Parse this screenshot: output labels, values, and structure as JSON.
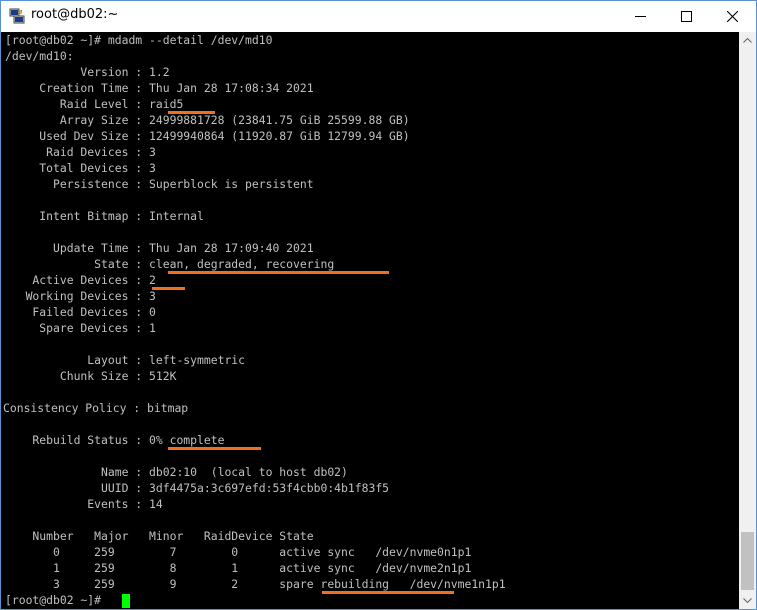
{
  "window": {
    "title": "root@db02:~",
    "icon": "putty-icon",
    "controls": [
      "minimize-icon",
      "maximize-icon",
      "close-icon"
    ]
  },
  "terminal": {
    "lines": [
      "[root@db02 ~]# mdadm --detail /dev/md10",
      "/dev/md10:",
      "           Version : 1.2",
      "     Creation Time : Thu Jan 28 17:08:34 2021",
      "        Raid Level : raid5",
      "        Array Size : 24999881728 (23841.75 GiB 25599.88 GB)",
      "     Used Dev Size : 12499940864 (11920.87 GiB 12799.94 GB)",
      "      Raid Devices : 3",
      "     Total Devices : 3",
      "       Persistence : Superblock is persistent",
      "",
      "     Intent Bitmap : Internal",
      "",
      "       Update Time : Thu Jan 28 17:09:40 2021",
      "             State : clean, degraded, recovering",
      "    Active Devices : 2",
      "   Working Devices : 3",
      "    Failed Devices : 0",
      "     Spare Devices : 1",
      "",
      "            Layout : left-symmetric",
      "        Chunk Size : 512K",
      "",
      "Consistency Policy : bitmap",
      "",
      "    Rebuild Status : 0% complete",
      "",
      "              Name : db02:10  (local to host db02)",
      "              UUID : 3df4475a:3c697efd:53f4cbb0:4b1f83f5",
      "            Events : 14",
      "",
      "    Number   Major   Minor   RaidDevice State",
      "       0     259        7        0      active sync   /dev/nvme0n1p1",
      "       1     259        8        1      active sync   /dev/nvme2n1p1",
      "       3     259        9        2      spare rebuilding   /dev/nvme1n1p1",
      "[root@db02 ~]# "
    ],
    "highlight_color": "#f07020",
    "text_color": "#c0c0c0",
    "cursor_color": "#00ff00"
  }
}
